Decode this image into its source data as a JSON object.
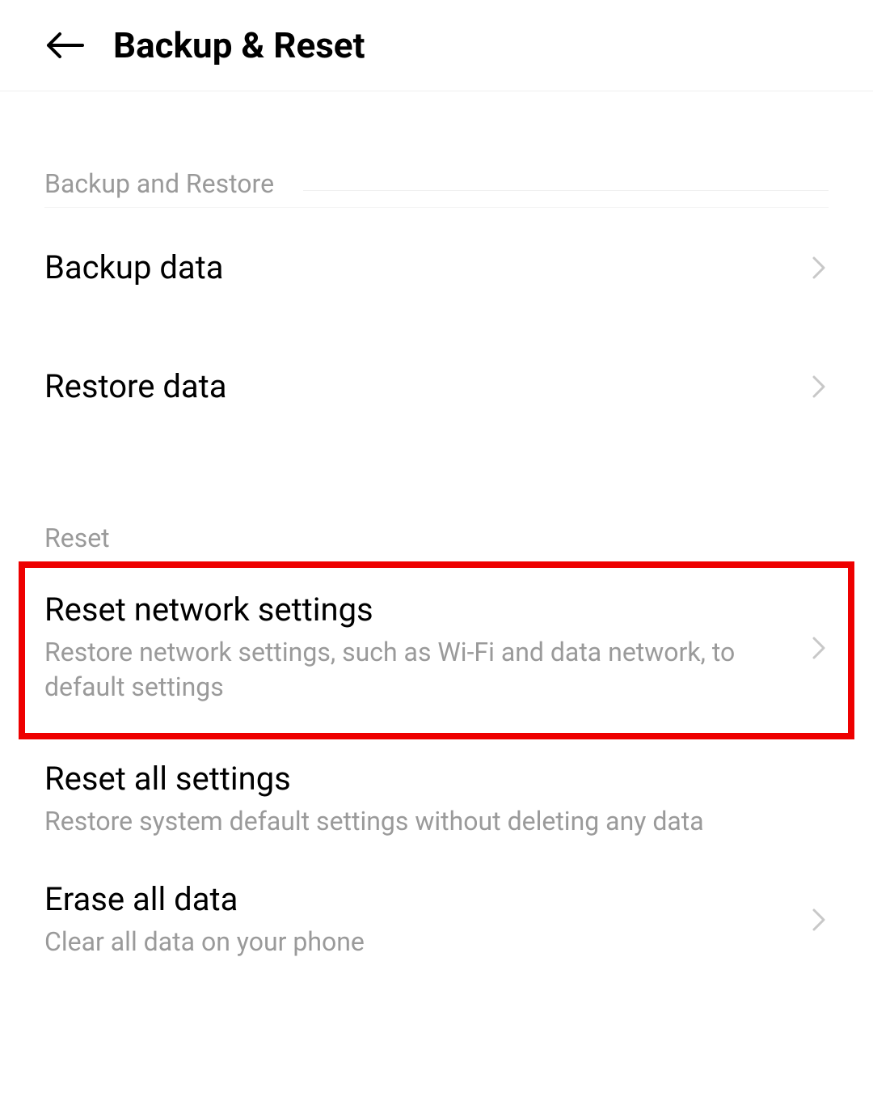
{
  "header": {
    "title": "Backup & Reset"
  },
  "sections": {
    "backup_restore": {
      "header": "Backup and Restore",
      "items": {
        "backup_data": {
          "title": "Backup data"
        },
        "restore_data": {
          "title": "Restore data"
        }
      }
    },
    "reset": {
      "header": "Reset",
      "items": {
        "reset_network": {
          "title": "Reset network settings",
          "subtitle": "Restore network settings, such as Wi-Fi and data network, to default settings"
        },
        "reset_all": {
          "title": "Reset all settings",
          "subtitle": "Restore system default settings without deleting any data"
        },
        "erase_all": {
          "title": "Erase all data",
          "subtitle": "Clear all data on your phone"
        }
      }
    }
  }
}
